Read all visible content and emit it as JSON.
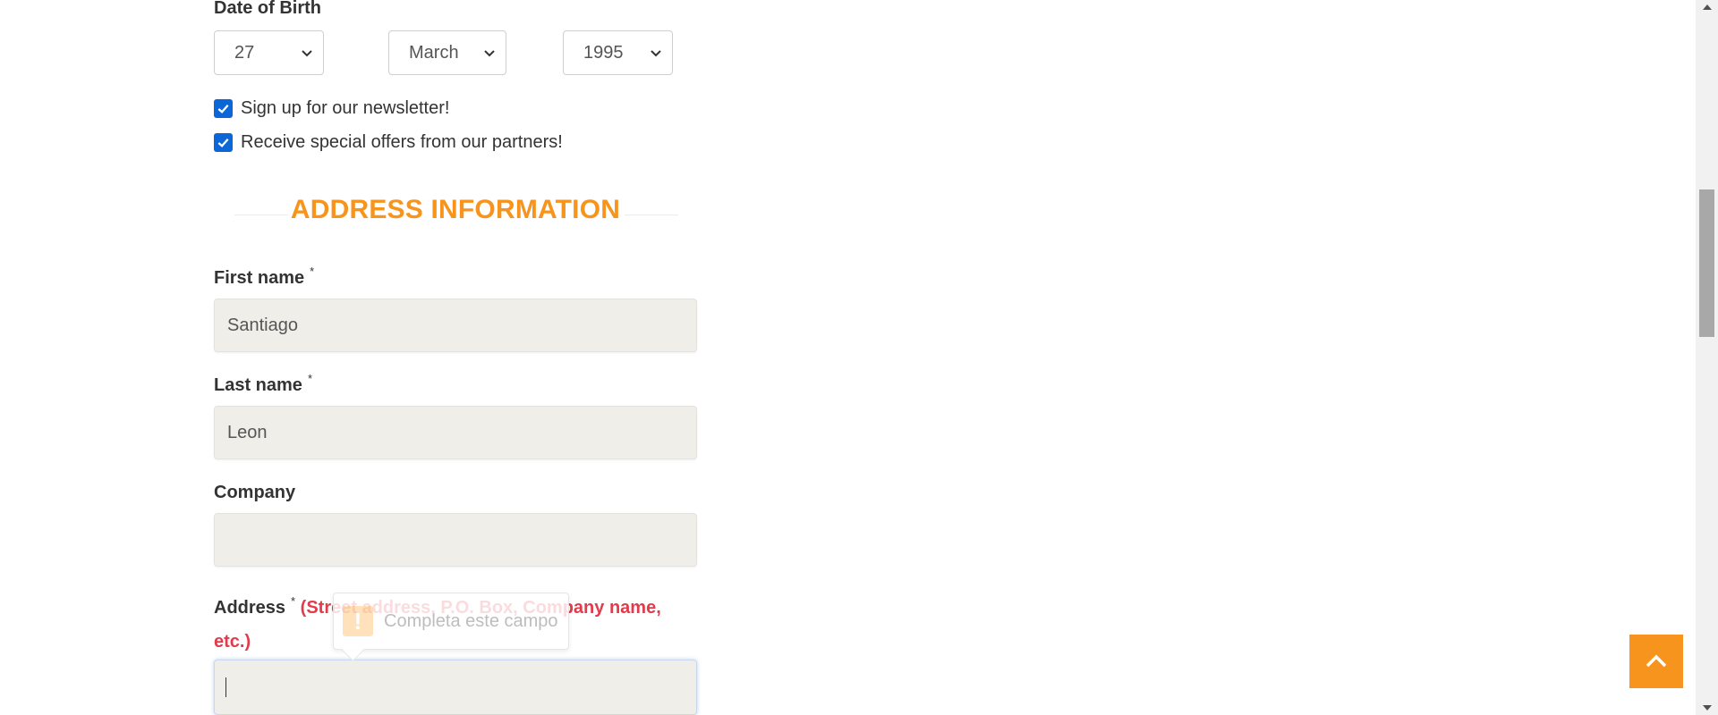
{
  "date_of_birth": {
    "label": "Date of Birth",
    "day": "27",
    "month": "March",
    "year": "1995"
  },
  "checkboxes": {
    "newsletter": "Sign up for our newsletter!",
    "offers": "Receive special offers from our partners!"
  },
  "section": {
    "title": "ADDRESS INFORMATION"
  },
  "fields": {
    "first_name_label": "First name",
    "first_name_value": "Santiago",
    "last_name_label": "Last name",
    "last_name_value": "Leon",
    "company_label": "Company",
    "company_value": "",
    "address_label": "Address",
    "address_hint": "(Street address, P.O. Box, Company name, etc.)",
    "address_value": "",
    "required_mark": "*"
  },
  "tooltip": {
    "message": "Completa este campo",
    "icon": "!"
  },
  "colors": {
    "accent": "#f7941d",
    "hint_red": "#e23b4b",
    "checkbox_blue": "#0b67d8",
    "input_bg": "#efeee8"
  },
  "icons": {
    "select_arrow": "chevron-down-icon",
    "checkbox": "checkmark-icon",
    "back_to_top": "chevron-up-icon",
    "tooltip": "warning-icon"
  }
}
